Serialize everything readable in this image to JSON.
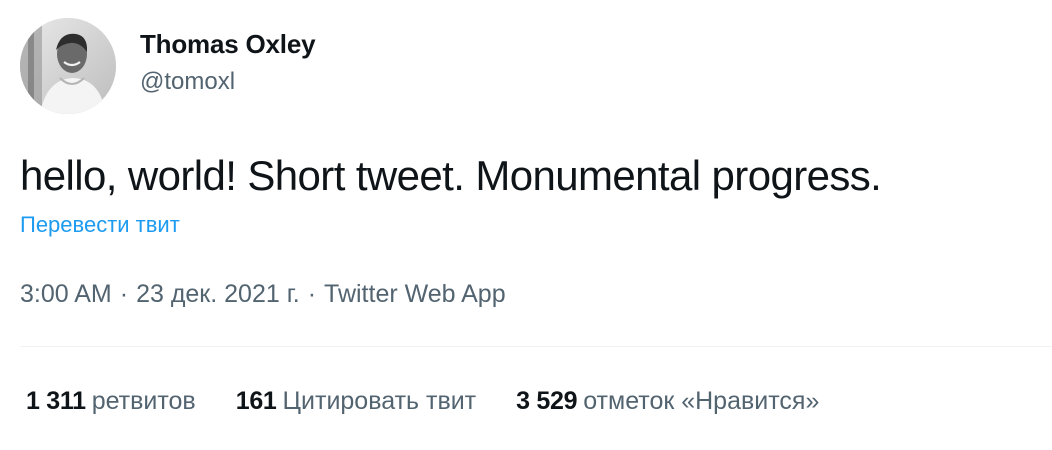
{
  "author": {
    "display_name": "Thomas Oxley",
    "handle": "@tomoxl",
    "avatar_icon": "avatar-photo"
  },
  "tweet": {
    "text": "hello, world! Short tweet. Monumental progress.",
    "translate_label": "Перевести твит"
  },
  "meta": {
    "time": "3:00 AM",
    "separator": "·",
    "date": "23 дек. 2021 г.",
    "source": "Twitter Web App"
  },
  "stats": {
    "retweets_count": "1 311",
    "retweets_label": "ретвитов",
    "quotes_count": "161",
    "quotes_label": "Цитировать твит",
    "likes_count": "3 529",
    "likes_label": "отметок «Нравится»"
  },
  "colors": {
    "text": "#0f1419",
    "secondary": "#536471",
    "link": "#1d9bf0",
    "divider": "#eff3f4"
  }
}
